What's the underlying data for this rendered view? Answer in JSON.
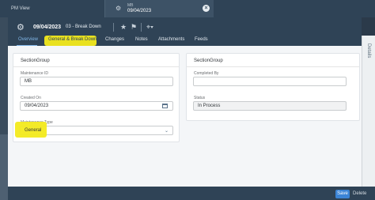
{
  "tabs": [
    {
      "label": "PM View"
    },
    {
      "subtitle": "MB",
      "title": "09/04/2023",
      "icon": "workorder-icon",
      "close_icon": "close-icon"
    }
  ],
  "header": {
    "icon": "maintenance-icon",
    "date": "09/04/2023",
    "type": "03 - Break Down",
    "actions": [
      "star-icon",
      "flag-icon",
      "tag-icon"
    ]
  },
  "nav": {
    "items": [
      "Overview",
      "General & Break Down",
      "Changes",
      "Notes",
      "Attachments",
      "Feeds"
    ],
    "active": "Overview"
  },
  "left_card": {
    "title": "SectionGroup",
    "fields": [
      {
        "label": "Maintenance ID",
        "value": "MB"
      },
      {
        "label": "Created On",
        "value": "09/04/2023"
      },
      {
        "label": "Maintenance Type",
        "value": "General"
      }
    ]
  },
  "right_card": {
    "title": "SectionGroup",
    "fields": [
      {
        "label": "Completed By",
        "value": ""
      },
      {
        "label": "Status",
        "value": "In Process"
      }
    ]
  },
  "side_panel": {
    "label": "Details"
  },
  "footer": {
    "save_label": "Save",
    "delete_label": "Delete"
  },
  "colors": {
    "accent": "#3b84d6",
    "highlight": "#f3ea1c",
    "shell": "#2f4356"
  }
}
